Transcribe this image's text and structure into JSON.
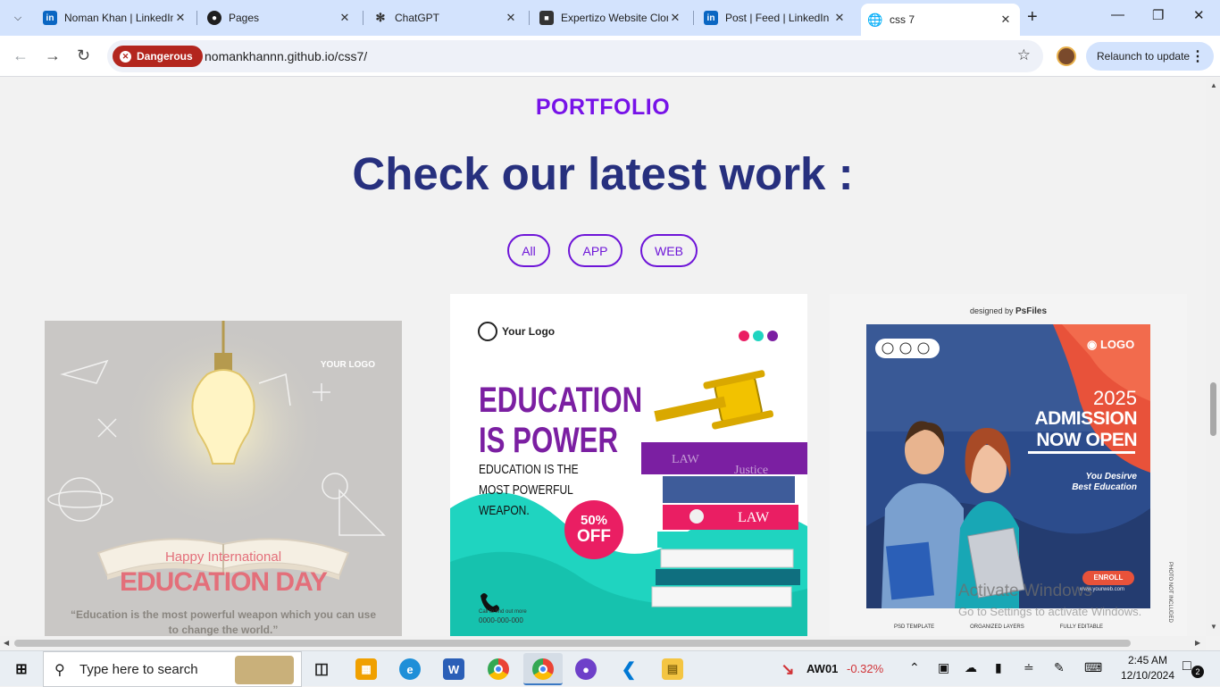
{
  "browser": {
    "tabs": [
      {
        "title": "Noman Khan | LinkedIn",
        "favicon": "linkedin-icon",
        "active": false
      },
      {
        "title": "Pages",
        "favicon": "github-icon",
        "active": false
      },
      {
        "title": "ChatGPT",
        "favicon": "chatgpt-icon",
        "active": false
      },
      {
        "title": "Expertizo Website Clone",
        "favicon": "contact-card-icon",
        "active": false
      },
      {
        "title": "Post | Feed | LinkedIn",
        "favicon": "linkedin-icon",
        "active": false
      },
      {
        "title": "css 7",
        "favicon": "globe-icon",
        "active": true
      }
    ],
    "security_badge": "Dangerous",
    "url": "nomankhannn.github.io/css7/",
    "relaunch_label": "Relaunch to update"
  },
  "page": {
    "kicker": "PORTFOLIO",
    "heading": "Check our latest work :",
    "filters": [
      "All",
      "APP",
      "WEB"
    ],
    "cards": [
      {
        "logo": "YOUR LOGO",
        "line1": "Happy International",
        "line2": "EDUCATION DAY",
        "quote1": "“Education is the most powerful weapon which you can use",
        "quote2": "to change the world.”"
      },
      {
        "logo": "Your Logo",
        "title1": "EDUCATION",
        "title2": "IS POWER",
        "sub1": "EDUCATION IS THE",
        "sub2": "MOST POWERFUL",
        "sub3": "WEAPON.",
        "badge_value": "50%",
        "badge_label": "OFF",
        "book_label": "LAW",
        "book_label2": "LAW",
        "book_label3": "Justice",
        "call_label": "Call to find out more",
        "call_number": "0000-000-000"
      },
      {
        "designed_by": "designed by",
        "brand": "PsFiles",
        "logo": "LOGO",
        "year": "2025",
        "line1": "ADMISSION",
        "line2": "NOW OPEN",
        "tag1": "You Desirve",
        "tag2": "Best Education",
        "enroll": "ENROLL",
        "website": "www.yourweb.com",
        "side_text": "PHOTO NOT INCLUDED",
        "footer": [
          "PSD TEMPLATE",
          "ORGANIZED LAYERS",
          "FULLY EDITABLE"
        ]
      }
    ]
  },
  "watermark": {
    "line1": "Activate Windows",
    "line2": "Go to Settings to activate Windows."
  },
  "taskbar": {
    "search_placeholder": "Type here to search",
    "stock_name": "AW01",
    "stock_change": "-0.32%",
    "time": "2:45 AM",
    "date": "12/10/2024",
    "notification_count": "2"
  },
  "colors": {
    "accent_purple": "#7712e8",
    "heading_navy": "#27307e",
    "danger_red": "#b3261e",
    "stock_red": "#d13438"
  }
}
